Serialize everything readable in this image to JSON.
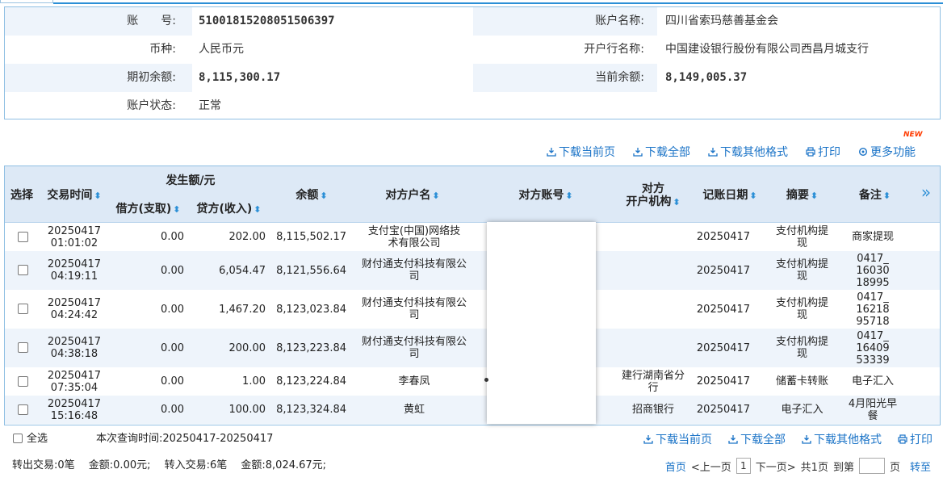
{
  "account": {
    "number_label": "账　　号:",
    "number": "51001815208051506397",
    "name_label": "账户名称:",
    "name": "四川省索玛慈善基金会",
    "currency_label": "币种:",
    "currency": "人民币元",
    "bank_label": "开户行名称:",
    "bank": "中国建设银行股份有限公司西昌月城支行",
    "opening_label": "期初余额:",
    "opening": "8,115,300.17",
    "current_label": "当前余额:",
    "current": "8,149,005.37",
    "status_label": "账户状态:",
    "status": "正常"
  },
  "toolbar": {
    "download_page": "下载当前页",
    "download_all": "下载全部",
    "download_other": "下载其他格式",
    "print": "打印",
    "more": "更多功能",
    "new_badge": "NEW"
  },
  "columns": {
    "select": "选择",
    "time": "交易时间",
    "amount_group": "发生额/元",
    "debit": "借方(支取)",
    "credit": "贷方(收入)",
    "balance": "余额",
    "counter_name": "对方户名",
    "counter_account": "对方账号",
    "counter_bank_1": "对方",
    "counter_bank_2": "开户机构",
    "post_date": "记账日期",
    "summary": "摘要",
    "remark": "备注",
    "expand": "»"
  },
  "rows": [
    {
      "date": "20250417",
      "time": "01:01:02",
      "debit": "0.00",
      "credit": "202.00",
      "balance": "8,115,502.17",
      "name1": "支付宝(中国)网络技",
      "name2": "术有限公司",
      "bank1": "",
      "bank2": "",
      "post": "20250417",
      "sum1": "支付机构提",
      "sum2": "现",
      "rem1": "商家提现",
      "rem2": "",
      "rem3": ""
    },
    {
      "date": "20250417",
      "time": "04:19:11",
      "debit": "0.00",
      "credit": "6,054.47",
      "balance": "8,121,556.64",
      "name1": "财付通支付科技有限公",
      "name2": "司",
      "bank1": "",
      "bank2": "",
      "post": "20250417",
      "sum1": "支付机构提",
      "sum2": "现",
      "rem1": "0417_",
      "rem2": "16030",
      "rem3": "18995"
    },
    {
      "date": "20250417",
      "time": "04:24:42",
      "debit": "0.00",
      "credit": "1,467.20",
      "balance": "8,123,023.84",
      "name1": "财付通支付科技有限公",
      "name2": "司",
      "bank1": "",
      "bank2": "",
      "post": "20250417",
      "sum1": "支付机构提",
      "sum2": "现",
      "rem1": "0417_",
      "rem2": "16218",
      "rem3": "95718"
    },
    {
      "date": "20250417",
      "time": "04:38:18",
      "debit": "0.00",
      "credit": "200.00",
      "balance": "8,123,223.84",
      "name1": "财付通支付科技有限公",
      "name2": "司",
      "bank1": "",
      "bank2": "",
      "post": "20250417",
      "sum1": "支付机构提",
      "sum2": "现",
      "rem1": "0417_",
      "rem2": "16409",
      "rem3": "53339"
    },
    {
      "date": "20250417",
      "time": "07:35:04",
      "debit": "0.00",
      "credit": "1.00",
      "balance": "8,123,224.84",
      "name1": "李春凤",
      "name2": "",
      "bank1": "建行湖南省分",
      "bank2": "行",
      "post": "20250417",
      "sum1": "储蓄卡转账",
      "sum2": "",
      "rem1": "电子汇入",
      "rem2": "",
      "rem3": ""
    },
    {
      "date": "20250417",
      "time": "15:16:48",
      "debit": "0.00",
      "credit": "100.00",
      "balance": "8,123,324.84",
      "name1": "黄虹",
      "name2": "",
      "bank1": "招商银行",
      "bank2": "",
      "post": "20250417",
      "sum1": "电子汇入",
      "sum2": "",
      "rem1": "4月阳光早",
      "rem2": "餐",
      "rem3": ""
    }
  ],
  "footer": {
    "select_all": "全选",
    "query_time": "本次查询时间:20250417-20250417",
    "download_page": "下载当前页",
    "download_all": "下载全部",
    "download_other": "下载其他格式",
    "print": "打印",
    "summary": "转出交易:0笔　 金额:0.00元;　 转入交易:6笔　 金额:8,024.67元;",
    "first": "首页",
    "prev": "<上一页",
    "page": "1",
    "next": "下一页>",
    "total": "共1页",
    "goto": "到第",
    "page_unit": "页",
    "go": "转至"
  }
}
